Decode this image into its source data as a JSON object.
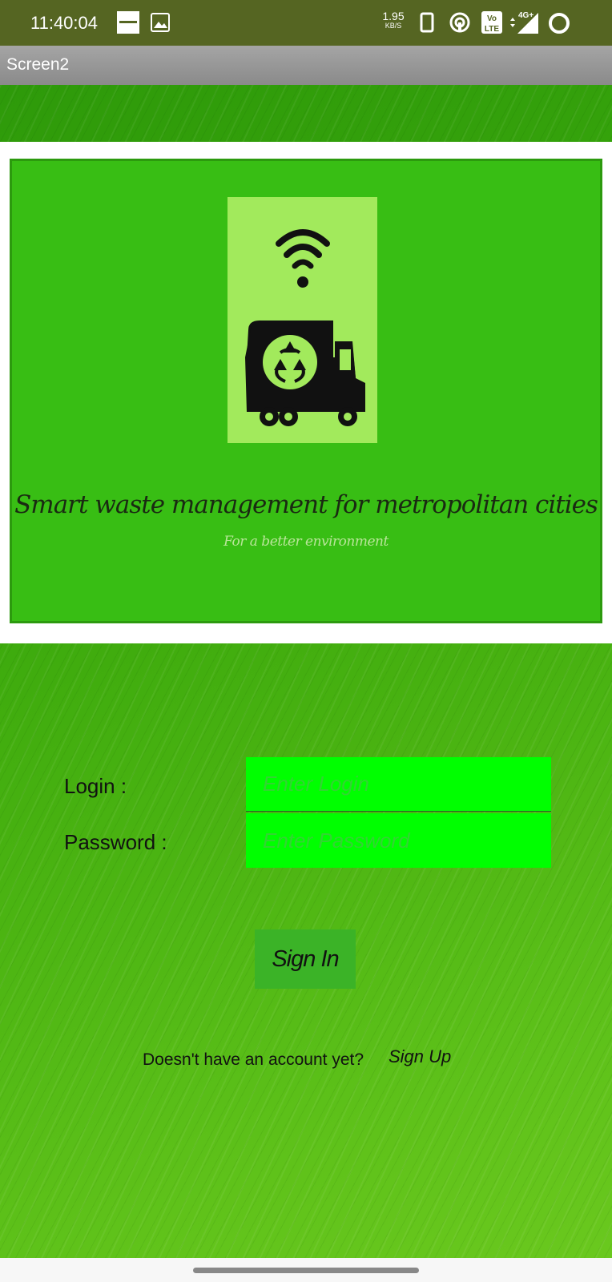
{
  "status_bar": {
    "time": "11:40:04",
    "speed_value": "1.95",
    "speed_unit": "KB/S",
    "network": "4G+",
    "volte": "Vo LTE",
    "icons": [
      "zomato-notification-icon",
      "gallery-icon",
      "phone-icon",
      "hotspot-icon",
      "volte-icon",
      "signal-icon",
      "battery-ring-icon"
    ]
  },
  "app": {
    "title": "Screen2"
  },
  "banner": {
    "title": "Smart waste management for metropolitan cities",
    "subtitle": "For a better environment",
    "icons": [
      "wifi-signal-icon",
      "recycling-truck-icon"
    ]
  },
  "form": {
    "login_label": "Login :",
    "login_placeholder": "Enter Login",
    "password_label": "Password :",
    "password_placeholder": "Enter Password",
    "signin_label": "Sign In"
  },
  "footer": {
    "prompt": "Doesn't have an account yet?",
    "signup_label": "Sign Up"
  },
  "colors": {
    "status_bar": "#556522",
    "banner_green": "#38be14",
    "logo_box": "#a2ea5c",
    "field_green": "#00ff00",
    "button_green": "#3bb327"
  }
}
